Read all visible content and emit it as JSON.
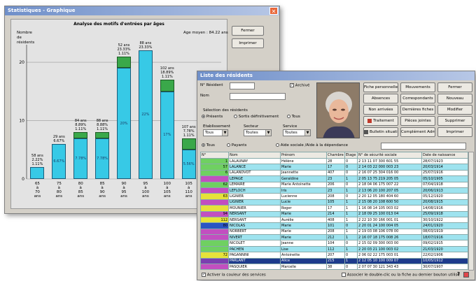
{
  "stats_window": {
    "title": "Statistiques - Graphique",
    "chart_heading": "Analyse des motifs d'entrées par âges",
    "y_caption": "Nombre de résidents",
    "avg_age": "Age moyen : 84.22 ans",
    "buttons": {
      "close": "Fermer",
      "print": "Imprimer"
    }
  },
  "chart_data": {
    "type": "bar",
    "title": "Analyse des motifs d'entrées par âges",
    "ylabel": "Nombre de résidents",
    "ylim": [
      0,
      23
    ],
    "yticks": [
      "0",
      "10",
      "20"
    ],
    "categories": [
      "65 à 70 ans",
      "75 à 80 ans",
      "80 à 85 ans",
      "85 à 90 ans",
      "90 à 95 ans",
      "95 à 100 ans",
      "100 à 105 ans",
      "105 à 110 ans",
      "+ de 110 ans"
    ],
    "category_labels": [
      [
        "65",
        "à",
        "70",
        "ans"
      ],
      [
        "75",
        "à",
        "80",
        "ans"
      ],
      [
        "80",
        "à",
        "85",
        "ans"
      ],
      [
        "85",
        "à",
        "90",
        "ans"
      ],
      [
        "90",
        "à",
        "95",
        "ans"
      ],
      [
        "95",
        "à",
        "100",
        "ans"
      ],
      [
        "100",
        "à",
        "105",
        "ans"
      ],
      [
        "105",
        "à",
        "110",
        "ans"
      ],
      [
        "+",
        "de",
        "110",
        "ans"
      ]
    ],
    "series": [
      {
        "values": [
          2,
          6,
          7,
          7,
          19,
          22,
          15,
          5,
          1
        ]
      },
      {
        "values": [
          0,
          0,
          1,
          1,
          2,
          0,
          2,
          2,
          0
        ]
      }
    ],
    "top_labels": [
      [
        "58 ans",
        "2.22%",
        "1.11%"
      ],
      [
        "29 ans",
        "6.67%"
      ],
      [
        "84 ans",
        "8.89%",
        "1.11%"
      ],
      [
        "88 ans",
        "8.88%",
        "1.11%"
      ],
      [
        "52 ans",
        "23.33%",
        "1.11%"
      ],
      [
        "88 ans",
        "23.33%"
      ],
      [
        "102 ans",
        "18.89%",
        "1.11%"
      ],
      [
        "107 ans",
        "7.78%",
        "1.11%"
      ],
      [
        "111 ans",
        "1.11%"
      ]
    ],
    "inner_labels": [
      "",
      "6.67%",
      "7.78%",
      "7.78%",
      "20%",
      "22%",
      "17%",
      "5.56%",
      "1.11%"
    ]
  },
  "list_window": {
    "title": "Liste des résidents",
    "labels": {
      "resident_no": "N° Résident",
      "name": "Nom",
      "archive": "Archivé",
      "selection": "Sélection des résidents"
    },
    "status_radios": [
      "Présents",
      "Sortis définitivement",
      "Tous"
    ],
    "combos": [
      {
        "label": "Etablissement",
        "value": "Tous"
      },
      {
        "label": "Secteur",
        "value": "Toutes"
      },
      {
        "label": "Service",
        "value": "Toutes"
      }
    ],
    "filter_radios": [
      "Tous",
      "Payants",
      "Aide sociale /Aide à la dépendance"
    ],
    "buttons": [
      "Fiche personnelle",
      "Mouvements",
      "Fermer",
      "Absences",
      "Correspondants",
      "Nouveau",
      "Non arrivées",
      "Dernières fiches",
      "Modifier",
      "Traitement",
      "Pièces jointes",
      "Supprimer",
      "Bulletin situation",
      "Complément Adm.",
      "Imprimer"
    ],
    "columns": [
      "N°",
      "Nom",
      "Prénom",
      "Chambre",
      "Etage",
      "N° de sécurité sociale",
      "Date de naissance"
    ],
    "rows": [
      [
        "",
        "LALAUNAY",
        "Hélène",
        "28",
        "0",
        "2 13 11 07 300 601 55",
        "28/07/1923"
      ],
      [
        "",
        "LALANCE",
        "Marie",
        "17",
        "0",
        "2 14 03 22 000 003 23",
        "20/03/1914"
      ],
      [
        "",
        "LALANDVOT",
        "Jeannette",
        "407",
        "0",
        "2 16 07 25 304 016 00",
        "25/07/1916"
      ],
      [
        "",
        "LEPAGE",
        "Geraldine",
        "23",
        "1",
        "2 05 13 75 219 205 05",
        "05/10/1905"
      ],
      [
        "",
        "LEMAIRE",
        "Marie Antoinette",
        "206",
        "0",
        "2 18 04 06 175 007 22",
        "07/04/1918"
      ],
      [
        "",
        "LEFLOCH",
        "Iris",
        "23",
        "1",
        "2 13 06 20 100 207 05",
        "20/06/1913"
      ],
      [
        "",
        "LIGNIER",
        "Lucienne",
        "208",
        "0",
        "2 20 12 05 180 404 60",
        "05/12/1920"
      ],
      [
        "",
        "LIGNIER",
        "Lucie",
        "105",
        "1",
        "2 15 08 20 108 600 50",
        "20/08/1915"
      ],
      [
        "",
        "MOUNIER",
        "Roger",
        "17",
        "1",
        "1 16 08 14 105 003 02",
        "14/08/1916"
      ],
      [
        "",
        "NERSANT",
        "Marie",
        "214",
        "1",
        "2 18 09 25 100 013 04",
        "25/09/1918"
      ],
      [
        "",
        "NERSANT",
        "Aurélie",
        "408",
        "1",
        "2 22 10 30 166 001 01",
        "30/10/1922"
      ],
      [
        "",
        "NICOLAS",
        "Marie",
        "101",
        "0",
        "2 20 01 24 100 004 05",
        "24/01/1920"
      ],
      [
        "",
        "NORBERT",
        "Marie",
        "208",
        "1",
        "2 19 03 08 106 078 00",
        "08/03/1919"
      ],
      [
        "",
        "NIVERT",
        "Marie",
        "212",
        "1",
        "2 16 07 18 175 008 26",
        "18/07/1916"
      ],
      [
        "",
        "NICOLET",
        "Jeanne",
        "104",
        "0",
        "2 15 02 09 300 003 00",
        "09/02/1915"
      ],
      [
        "",
        "PACHEN",
        "Lise",
        "112",
        "1",
        "2 20 03 21 100 003 02",
        "21/03/1920"
      ],
      [
        "",
        "PAGANNINI",
        "Antoinette",
        "207",
        "0",
        "2 06 02 22 175 003 01",
        "22/02/1906"
      ],
      [
        "",
        "PARLANT",
        "Alice",
        "215",
        "1",
        "2 12 05 10 100 009 07",
        "10/05/1912"
      ],
      [
        "",
        "PASQUIER",
        "Marcelle",
        "38",
        "0",
        "2 07 07 30 121 343 43",
        "30/07/1907"
      ]
    ],
    "row_numbers": [
      "1",
      "57",
      "6",
      "",
      "62",
      "",
      "63",
      "",
      "",
      "94",
      "112",
      "80",
      "",
      "",
      "",
      "",
      "72",
      "",
      ""
    ],
    "footer": {
      "colors_label": "Activer la couleur des services",
      "option_label": "Associer le double-clic ou la fiche au dernier bouton utilisé",
      "help": "?"
    }
  }
}
